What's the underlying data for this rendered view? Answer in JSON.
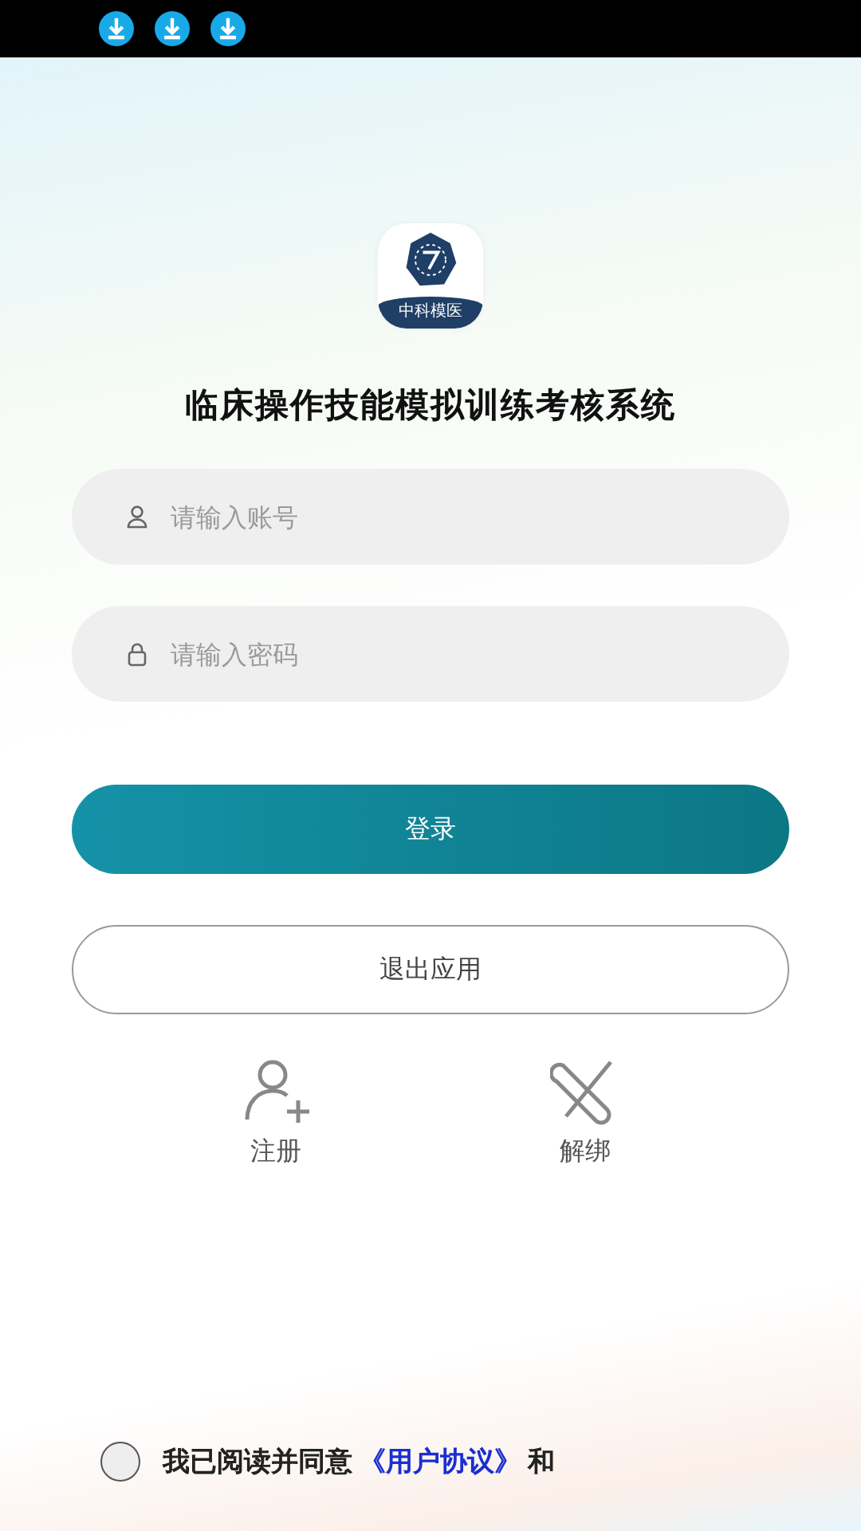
{
  "status_bar": {
    "notifications": [
      {
        "kind": "download"
      },
      {
        "kind": "download"
      },
      {
        "kind": "download"
      }
    ]
  },
  "logo": {
    "text": "中科模医"
  },
  "title": "临床操作技能模拟训练考核系统",
  "fields": [
    {
      "kind": "user",
      "placeholder": "请输入账号"
    },
    {
      "kind": "lock",
      "placeholder": "请输入密码"
    }
  ],
  "login_button": "登录",
  "exit_button": "退出应用",
  "actions": [
    {
      "kind": "register",
      "label": "注册"
    },
    {
      "kind": "unbind",
      "label": "解绑"
    }
  ],
  "agreement": {
    "checked": false,
    "text": "我已阅读并同意",
    "link": "《用户协议》",
    "conjunction": "和"
  }
}
